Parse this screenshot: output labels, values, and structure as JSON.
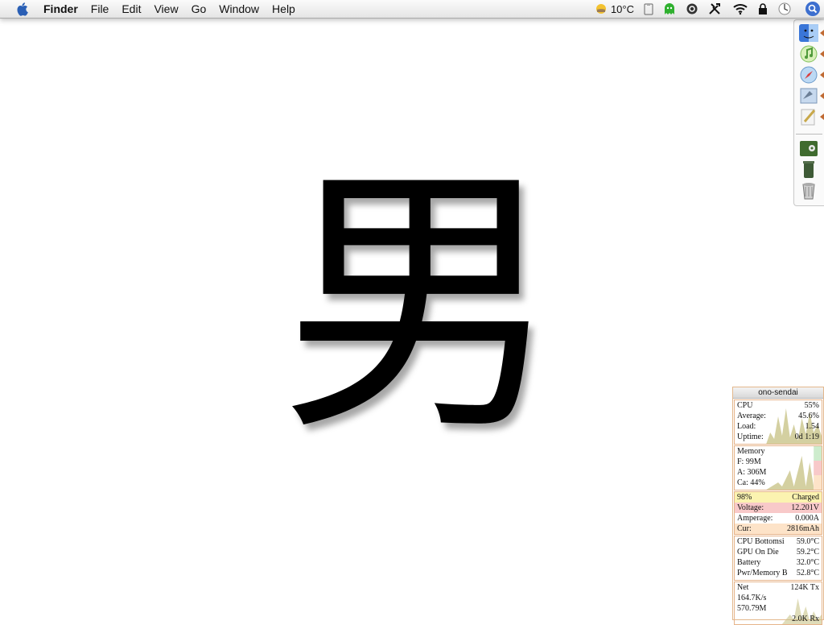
{
  "menubar": {
    "app_name": "Finder",
    "menus": [
      "File",
      "Edit",
      "View",
      "Go",
      "Window",
      "Help"
    ],
    "temperature": "10°C",
    "icons": [
      "apple-icon",
      "weather-icon",
      "clipboard-icon",
      "ghost-icon",
      "sync-icon",
      "tools-icon",
      "wifi-icon",
      "lock-icon",
      "clock-icon",
      "spotlight-icon"
    ]
  },
  "glyph": {
    "text": "男"
  },
  "dock": {
    "items": [
      "finder-icon",
      "itunes-icon",
      "safari-icon",
      "mail-icon",
      "textedit-icon",
      "garage-icon",
      "trash-bin-icon",
      "trash-can-icon"
    ]
  },
  "monitor": {
    "host": "ono-sendai",
    "cpu": {
      "label": "CPU",
      "value": "55%",
      "average_label": "Average:",
      "average": "45.6%",
      "load_label": "Load:",
      "load": "1.54",
      "uptime_label": "Uptime:",
      "uptime": "0d 1:19"
    },
    "memory": {
      "label": "Memory",
      "free": "F: 99M",
      "active": "A: 306M",
      "cache": "Ca: 44%"
    },
    "battery": {
      "percent": "98%",
      "status": "Charged",
      "voltage_label": "Voltage:",
      "voltage": "12.201V",
      "amperage_label": "Amperage:",
      "amperage": "0.000A",
      "cur_label": "Cur:",
      "cur": "2816mAh"
    },
    "temps": [
      {
        "label": "CPU Bottomsi",
        "value": "59.0°C"
      },
      {
        "label": "GPU On Die",
        "value": "59.2°C"
      },
      {
        "label": "Battery",
        "value": "32.0°C"
      },
      {
        "label": "Pwr/Memory B",
        "value": "52.8°C"
      }
    ],
    "net": {
      "label": "Net",
      "tx": "124K Tx",
      "rate": "164.7K/s",
      "total": "570.79M",
      "rx": "2.0K Rx"
    }
  },
  "colors": {
    "accent_orange": "#e3b78c",
    "graph_olive": "#c9c48a",
    "highlight_pink": "#f8c9c9"
  }
}
